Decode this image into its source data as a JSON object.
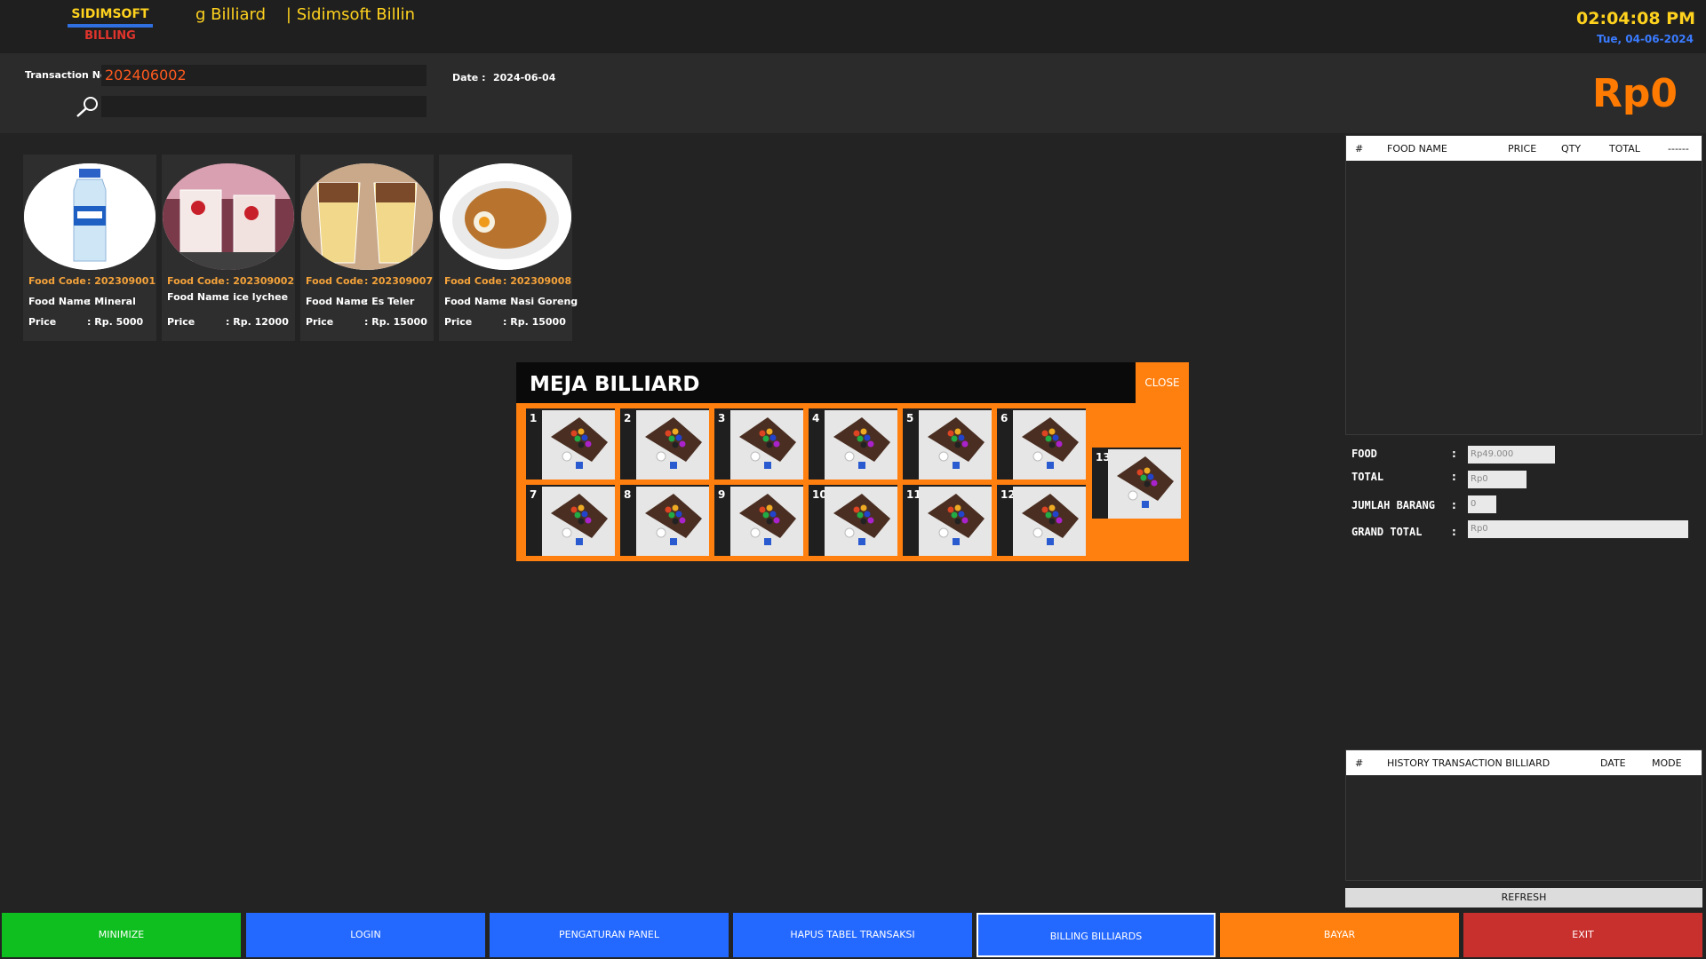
{
  "header": {
    "logo_top": "SIDIMSOFT",
    "logo_bottom": "BILLING",
    "marquee": "g Billiard    | Sidimsoft Billin",
    "clock": "02:04:08 PM",
    "date": "Tue, 04-06-2024"
  },
  "transaction": {
    "label": "Transaction No",
    "number": "202406002",
    "date_label": "Date :",
    "date_value": "2024-06-04",
    "total": "Rp0"
  },
  "food_labels": {
    "code": "Food Code",
    "name": "Food Name",
    "price": "Price"
  },
  "foods": [
    {
      "code": ": 202309001",
      "name": ": Mineral",
      "price": ": Rp. 5000"
    },
    {
      "code": ": 202309002",
      "name": ": ice lychee",
      "price": ": Rp. 12000"
    },
    {
      "code": ": 202309007",
      "name": ": Es Teler",
      "price": ": Rp. 15000"
    },
    {
      "code": ": 202309008",
      "name": ": Nasi Goreng",
      "price": ": Rp. 15000"
    }
  ],
  "billiard_modal": {
    "title": "MEJA BILLIARD",
    "close": "CLOSE",
    "tables": [
      "1",
      "2",
      "3",
      "4",
      "5",
      "6",
      "7",
      "8",
      "9",
      "10",
      "11",
      "12",
      "13"
    ]
  },
  "cart": {
    "headers": [
      "#",
      "FOOD NAME",
      "PRICE",
      "QTY",
      "TOTAL",
      "------"
    ]
  },
  "summary": {
    "food_label": "FOOD",
    "food_value": "Rp49.000",
    "total_label": "TOTAL",
    "total_value": "Rp0",
    "jumlah_label": "JUMLAH BARANG",
    "jumlah_value": "0",
    "grand_label": "GRAND  TOTAL",
    "grand_value": "Rp0",
    "colon": ":"
  },
  "history": {
    "headers": [
      "#",
      "HISTORY TRANSACTION BILLIARD",
      "DATE",
      "MODE"
    ],
    "refresh": "REFRESH"
  },
  "buttons": {
    "minimize": "MINIMIZE",
    "login": "LOGIN",
    "pengaturan": "PENGATURAN PANEL",
    "hapus": "HAPUS TABEL TRANSAKSI",
    "billing": "BILLING BILLIARDS",
    "bayar": "BAYAR",
    "exit": "EXIT"
  },
  "colors": {
    "accent_orange": "#ff7f0f",
    "green": "#0fbf1f",
    "blue": "#2368ff",
    "red": "#c8302e",
    "yellow": "#ffd21e"
  }
}
